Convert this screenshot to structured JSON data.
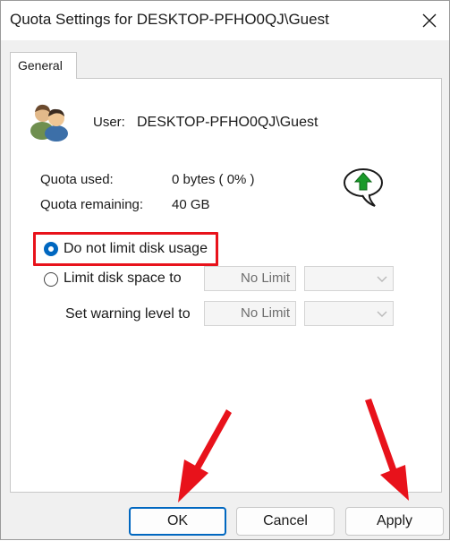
{
  "window": {
    "title": "Quota Settings for DESKTOP-PFHO0QJ\\Guest"
  },
  "tabs": [
    {
      "label": "General"
    }
  ],
  "user": {
    "label": "User:",
    "value": "DESKTOP-PFHO0QJ\\Guest"
  },
  "quota": {
    "used_label": "Quota used:",
    "used_value": "0 bytes ( 0% )",
    "remaining_label": "Quota remaining:",
    "remaining_value": "40 GB"
  },
  "options": {
    "no_limit_label": "Do not limit disk usage",
    "limit_label": "Limit disk space to",
    "limit_value": "No Limit",
    "warning_label": "Set warning level to",
    "warning_value": "No Limit",
    "selected": "no_limit"
  },
  "buttons": {
    "ok": "OK",
    "cancel": "Cancel",
    "apply": "Apply"
  },
  "colors": {
    "accent": "#0067c0",
    "annotation": "#e8121b",
    "arrow_icon": "#1a9a2a"
  },
  "icons": {
    "users": "users-icon",
    "arrow": "up-arrow-icon",
    "close": "close-icon"
  }
}
